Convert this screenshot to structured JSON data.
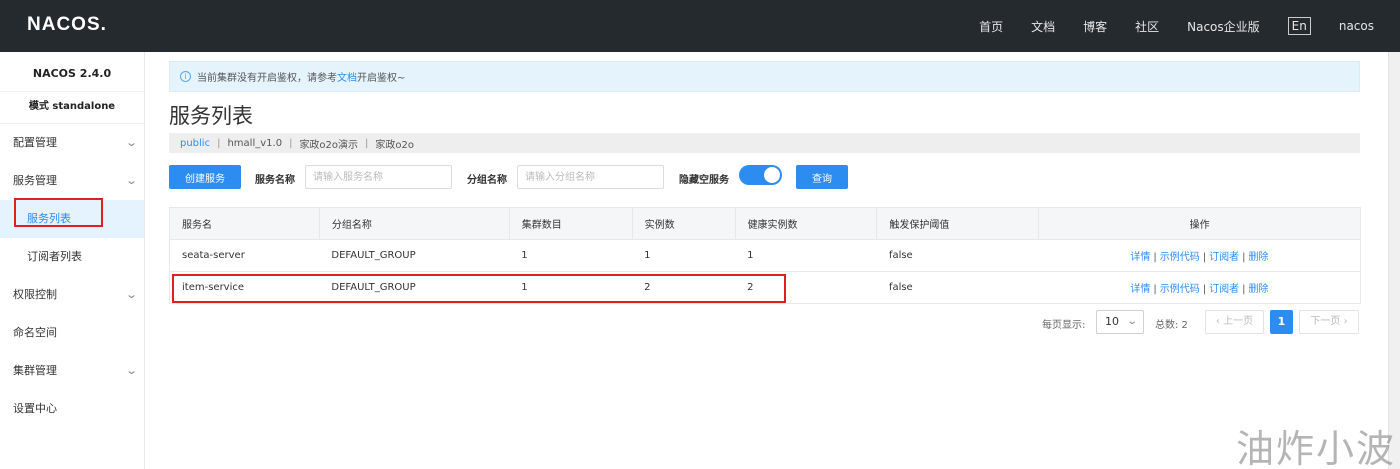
{
  "header": {
    "logo": "NACOS.",
    "nav": [
      "首页",
      "文档",
      "博客",
      "社区",
      "Nacos企业版"
    ],
    "lang": "En",
    "user": "nacos"
  },
  "sidebar": {
    "version": "NACOS 2.4.0",
    "mode": "模式 standalone",
    "items": [
      {
        "label": "配置管理"
      },
      {
        "label": "服务管理"
      },
      {
        "label": "服务列表"
      },
      {
        "label": "订阅者列表"
      },
      {
        "label": "权限控制"
      },
      {
        "label": "命名空间"
      },
      {
        "label": "集群管理"
      },
      {
        "label": "设置中心"
      }
    ]
  },
  "notice": {
    "text_before": "当前集群没有开启鉴权，请参考",
    "link": "文档",
    "text_after": "开启鉴权~"
  },
  "page_title": "服务列表",
  "namespaces": [
    "public",
    "hmall_v1.0",
    "家政o2o演示",
    "家政o2o"
  ],
  "toolbar": {
    "create_label": "创建服务",
    "service_name_label": "服务名称",
    "service_name_placeholder": "请输入服务名称",
    "group_name_label": "分组名称",
    "group_name_placeholder": "请输入分组名称",
    "hide_empty_label": "隐藏空服务",
    "query_label": "查询"
  },
  "table": {
    "columns": [
      "服务名",
      "分组名称",
      "集群数目",
      "实例数",
      "健康实例数",
      "触发保护阈值",
      "操作"
    ],
    "rows": [
      [
        "seata-server",
        "DEFAULT_GROUP",
        "1",
        "1",
        "1",
        "false"
      ],
      [
        "item-service",
        "DEFAULT_GROUP",
        "1",
        "2",
        "2",
        "false"
      ]
    ],
    "ops": [
      "详情",
      "示例代码",
      "订阅者",
      "删除"
    ]
  },
  "pagination": {
    "page_size_label": "每页显示:",
    "page_size": "10",
    "total_label": "总数: 2",
    "prev": "上一页",
    "next": "下一页",
    "current": "1"
  },
  "watermark": "油炸小波",
  "colors": {
    "topbar": "#252a2f",
    "primary": "#2d8cf0",
    "highlight": "#e02020"
  }
}
